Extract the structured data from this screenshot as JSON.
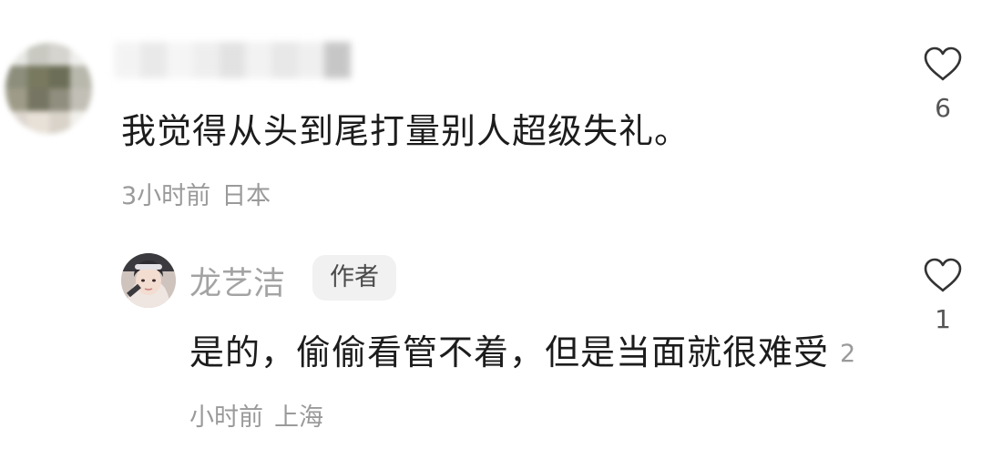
{
  "comments": {
    "main": {
      "text": "我觉得从头到尾打量别人超级失礼。",
      "time": "3小时前",
      "location": "日本",
      "likes": "6",
      "avatar_icon": "blurred-avatar",
      "username_icon": "blurred-username"
    },
    "reply": {
      "username": "龙艺洁",
      "badge": "作者",
      "text": "是的，偷偷看管不着，但是当面就很难受",
      "time": "2小时前",
      "location": "上海",
      "likes": "1",
      "avatar_icon": "user-avatar"
    }
  },
  "icons": {
    "like": "heart-outline-icon"
  },
  "colors": {
    "text_primary": "#1c1c1c",
    "text_meta": "#9a9a9a",
    "username": "#a3a3a3",
    "badge_bg": "#f1f1f1",
    "icon_stroke": "#333333"
  }
}
